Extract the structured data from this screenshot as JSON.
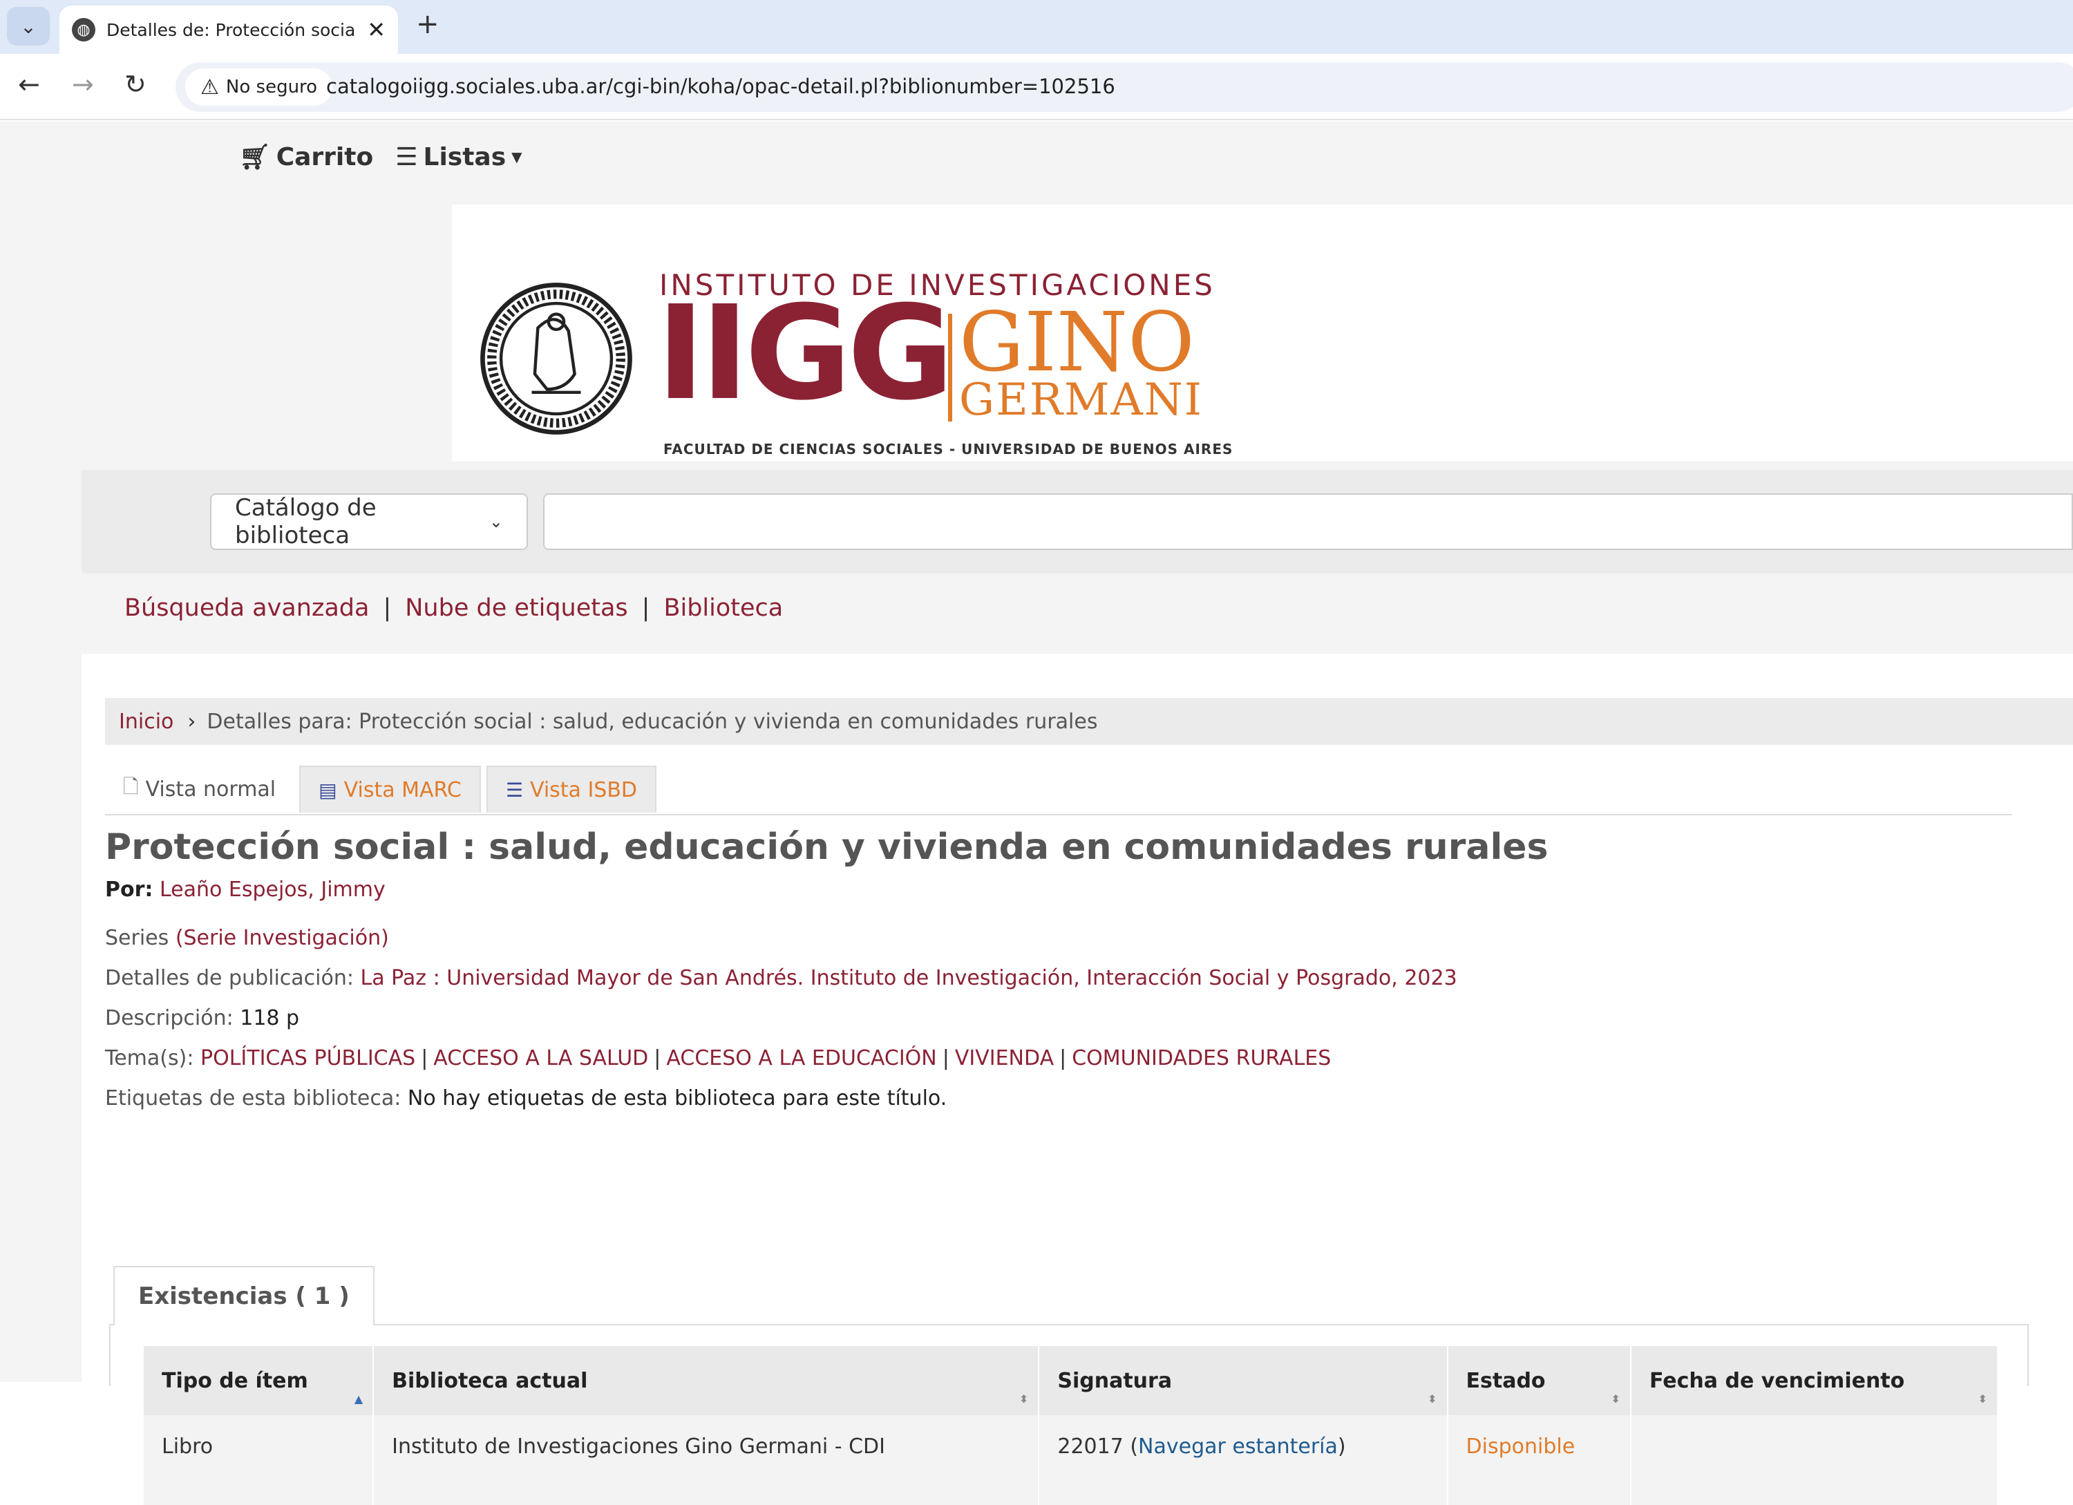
{
  "browser": {
    "tab_title": "Detalles de: Protección social : s",
    "security_label": "No seguro",
    "url": "catalogoiigg.sociales.uba.ar/cgi-bin/koha/opac-detail.pl?biblionumber=102516"
  },
  "topnav": {
    "cart": "Carrito",
    "lists": "Listas"
  },
  "logo": {
    "top": "INSTITUTO DE INVESTIGACIONES",
    "iigg": "IIGG",
    "gino": "GINO",
    "germani": "GERMANI",
    "faculty": "FACULTAD DE CIENCIAS SOCIALES - UNIVERSIDAD DE BUENOS AIRES"
  },
  "search": {
    "scope": "Catálogo de biblioteca"
  },
  "links": [
    "Búsqueda avanzada",
    "Nube de etiquetas",
    "Biblioteca"
  ],
  "breadcrumb": {
    "home": "Inicio",
    "current": "Detalles para: Protección social : salud, educación y vivienda en comunidades rurales"
  },
  "views": {
    "normal": "Vista normal",
    "marc": "Vista MARC",
    "isbd": "Vista ISBD"
  },
  "record": {
    "title": "Protección social : salud, educación y vivienda en comunidades rurales",
    "author_label": "Por:",
    "author": "Leaño Espejos, Jimmy",
    "series_label": "Series",
    "series": "(Serie Investigación)",
    "publication_label": "Detalles de publicación:",
    "publication": "La Paz : Universidad Mayor de San Andrés. Instituto de Investigación, Interacción Social y Posgrado, 2023",
    "description_label": "Descripción:",
    "description": "118 p",
    "subjects_label": "Tema(s):",
    "subjects": [
      "POLÍTICAS PÚBLICAS",
      "ACCESO A LA SALUD",
      "ACCESO A LA EDUCACIÓN",
      "VIVIENDA",
      "COMUNIDADES RURALES"
    ],
    "tags_label": "Etiquetas de esta biblioteca:",
    "tags": "No hay etiquetas de esta biblioteca para este título."
  },
  "holdings": {
    "tab_label": "Existencias ( 1 )",
    "columns": [
      "Tipo de ítem",
      "Biblioteca actual",
      "Signatura",
      "Estado",
      "Fecha de vencimiento"
    ],
    "rows": [
      {
        "type": "Libro",
        "library": "Instituto de Investigaciones Gino Germani - CDI",
        "callnumber": "22017",
        "browse_label": "Navegar estantería",
        "status": "Disponible",
        "due": ""
      }
    ]
  },
  "colors": {
    "brand_red": "#8b2234",
    "brand_orange": "#e07b2a"
  }
}
